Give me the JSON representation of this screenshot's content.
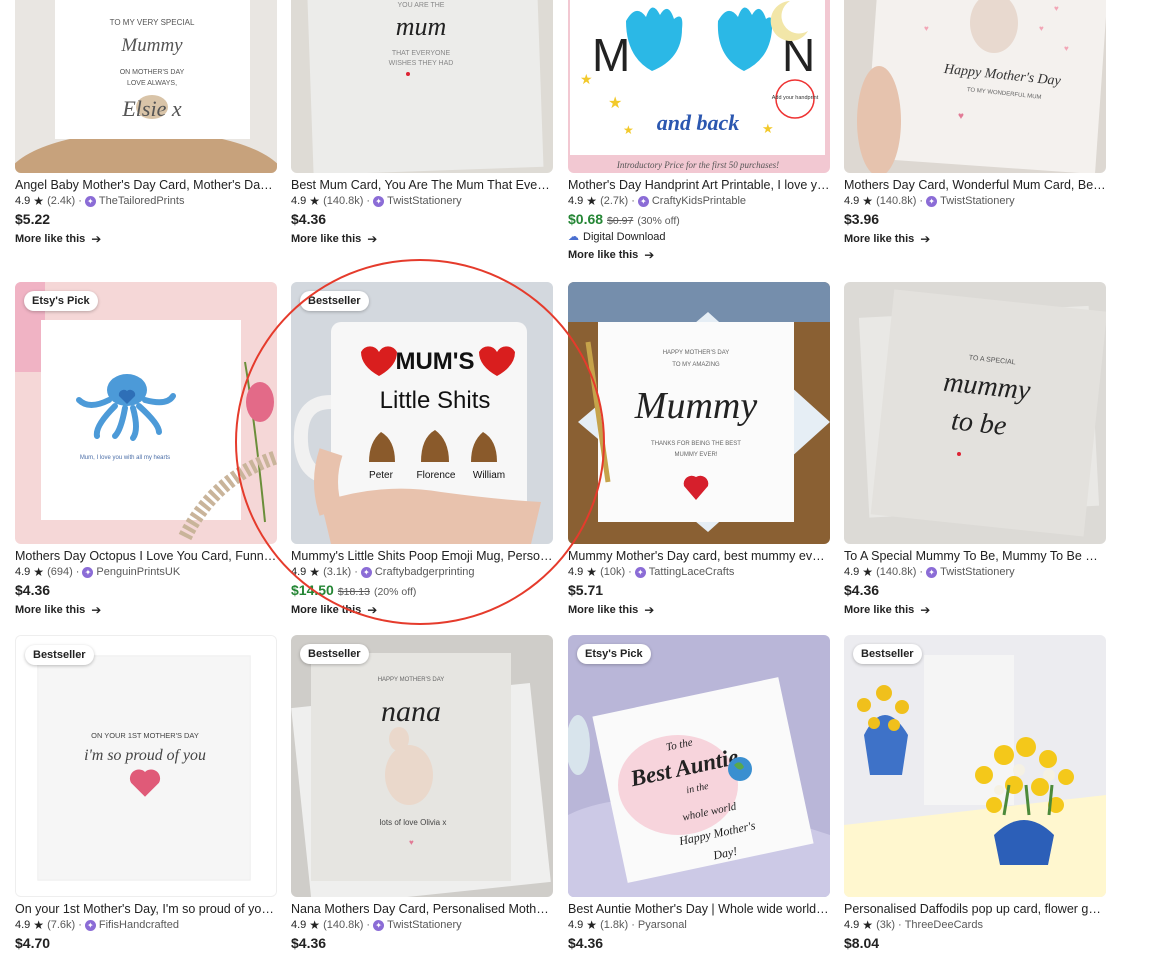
{
  "colors": {
    "accent_sale": "#258635",
    "annotation_circle": "#e53b2c",
    "star": "#222222",
    "shop_icon": "#8b6cd6"
  },
  "listings": [
    {
      "title": "Angel Baby Mother's Day Card, Mother's Day Card...",
      "rating": "4.9",
      "reviews": "(2.4k)",
      "shop": "TheTailoredPrints",
      "star_seller": true,
      "price": "$5.22",
      "more": "More like this"
    },
    {
      "title": "Best Mum Card, You Are The Mum That Everyone...",
      "rating": "4.9",
      "reviews": "(140.8k)",
      "shop": "TwistStationery",
      "star_seller": true,
      "price": "$4.36",
      "more": "More like this"
    },
    {
      "title": "Mother's Day Handprint Art Printable, I love you...",
      "rating": "4.9",
      "reviews": "(2.7k)",
      "shop": "CraftyKidsPrintable",
      "star_seller": true,
      "price": "$0.68",
      "original_price": "$0.97",
      "discount": "(30% off)",
      "digital": "Digital Download",
      "more": "More like this"
    },
    {
      "title": "Mothers Day Card, Wonderful Mum Card, Best...",
      "rating": "4.9",
      "reviews": "(140.8k)",
      "shop": "TwistStationery",
      "star_seller": true,
      "price": "$3.96",
      "more": "More like this"
    },
    {
      "badge": "Etsy's Pick",
      "title": "Mothers Day Octopus I Love You Card, Funny ...",
      "rating": "4.9",
      "reviews": "(694)",
      "shop": "PenguinPrintsUK",
      "star_seller": true,
      "price": "$4.36",
      "more": "More like this"
    },
    {
      "badge": "Bestseller",
      "title": "Mummy's Little Shits Poop Emoji Mug, Person...",
      "rating": "4.9",
      "reviews": "(3.1k)",
      "shop": "Craftybadgerprinting",
      "star_seller": true,
      "price": "$14.50",
      "original_price": "$18.13",
      "discount": "(20% off)",
      "more": "More like this"
    },
    {
      "title": "Mummy Mother's Day card, best mummy ever,...",
      "rating": "4.9",
      "reviews": "(10k)",
      "shop": "TattingLaceCrafts",
      "star_seller": true,
      "price": "$5.71",
      "more": "More like this"
    },
    {
      "title": "To A Special Mummy To Be, Mummy To Be Car...",
      "rating": "4.9",
      "reviews": "(140.8k)",
      "shop": "TwistStationery",
      "star_seller": true,
      "price": "$4.36",
      "more": "More like this"
    },
    {
      "badge": "Bestseller",
      "title": "On your 1st Mother's Day, I'm so proud of you, ...",
      "rating": "4.9",
      "reviews": "(7.6k)",
      "shop": "FifisHandcrafted",
      "star_seller": true,
      "price": "$4.70"
    },
    {
      "badge": "Bestseller",
      "title": "Nana Mothers Day Card, Personalised Mothers...",
      "rating": "4.9",
      "reviews": "(140.8k)",
      "shop": "TwistStationery",
      "star_seller": true,
      "price": "$4.36"
    },
    {
      "badge": "Etsy's Pick",
      "title": "Best Auntie Mother's Day | Whole wide world | ...",
      "rating": "4.9",
      "reviews": "(1.8k)",
      "shop": "Pyarsonal",
      "star_seller": false,
      "price": "$4.36"
    },
    {
      "badge": "Bestseller",
      "title": "Personalised Daffodils pop up card, flower gar...",
      "rating": "4.9",
      "reviews": "(3k)",
      "shop": "ThreeDeeCards",
      "star_seller": false,
      "price": "$8.04"
    }
  ],
  "art": {
    "a0": [
      "TO MY VERY SPECIAL",
      "Mummy",
      "ON MOTHER'S DAY",
      "LOVE ALWAYS,",
      "Elsie x"
    ],
    "a1": [
      "YOU ARE THE",
      "mum",
      "THAT EVERYONE",
      "WISHES THEY HAD"
    ],
    "a2": [
      "M",
      "N",
      "and back",
      "Add your handprint",
      "Introductory Price for the first 50 purchases!"
    ],
    "a3": [
      "Happy Mother's Day",
      "TO MY WONDERFUL MUM"
    ],
    "a4": [
      "Mum, I love you with all my hearts"
    ],
    "a5": [
      "MUM'S",
      "Little Shits",
      "Peter",
      "Florence",
      "William"
    ],
    "a6": [
      "HAPPY MOTHER'S DAY",
      "TO MY AMAZING",
      "Mummy",
      "THANKS FOR BEING THE BEST",
      "MUMMY EVER!"
    ],
    "a7": [
      "TO A SPECIAL",
      "mummy",
      "to be"
    ],
    "a8": [
      "ON YOUR 1ST MOTHER'S DAY",
      "i'm so proud of you"
    ],
    "a9": [
      "HAPPY MOTHER'S DAY",
      "nana",
      "lots of love Olivia x"
    ],
    "a10": [
      "To the",
      "Best Auntie",
      "in the",
      "whole world",
      "Happy Mother's",
      "Day!"
    ]
  }
}
